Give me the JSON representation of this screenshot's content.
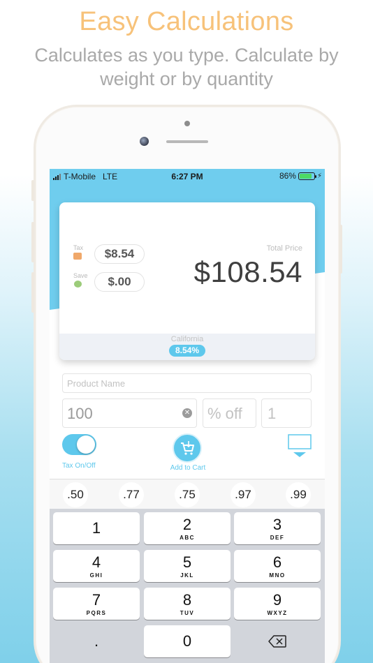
{
  "promo": {
    "headline": "Easy Calculations",
    "subline": "Calculates as you type. Calculate by weight or by quantity"
  },
  "status_bar": {
    "carrier": "T-Mobile",
    "network": "LTE",
    "time": "6:27 PM",
    "battery": "86%",
    "battery_level": 0.86
  },
  "price_card": {
    "tax_label": "Tax",
    "tax_value": "$8.54",
    "save_label": "Save",
    "save_value": "$.00",
    "total_label": "Total Price",
    "total_value": "$108.54",
    "state": "California",
    "tax_rate": "8.54%"
  },
  "form": {
    "product_placeholder": "Product Name",
    "price_value": "100",
    "percent_placeholder": "% off",
    "quantity_placeholder": "1",
    "tax_toggle_label": "Tax On/Off",
    "tax_toggle_on": true,
    "add_to_cart_label": "Add to Cart"
  },
  "keyboard": {
    "quick_amounts": [
      ".50",
      ".77",
      ".75",
      ".97",
      ".99"
    ],
    "keys": [
      {
        "num": "1",
        "letters": ""
      },
      {
        "num": "2",
        "letters": "ABC"
      },
      {
        "num": "3",
        "letters": "DEF"
      },
      {
        "num": "4",
        "letters": "GHI"
      },
      {
        "num": "5",
        "letters": "JKL"
      },
      {
        "num": "6",
        "letters": "MNO"
      },
      {
        "num": "7",
        "letters": "PQRS"
      },
      {
        "num": "8",
        "letters": "TUV"
      },
      {
        "num": "9",
        "letters": "WXYZ"
      },
      {
        "num": ".",
        "letters": ""
      },
      {
        "num": "0",
        "letters": ""
      },
      {
        "num": "",
        "letters": ""
      }
    ]
  },
  "colors": {
    "accent": "#5ec8ec",
    "headline": "#f7c27a",
    "total_text": "#3f3f3f"
  }
}
